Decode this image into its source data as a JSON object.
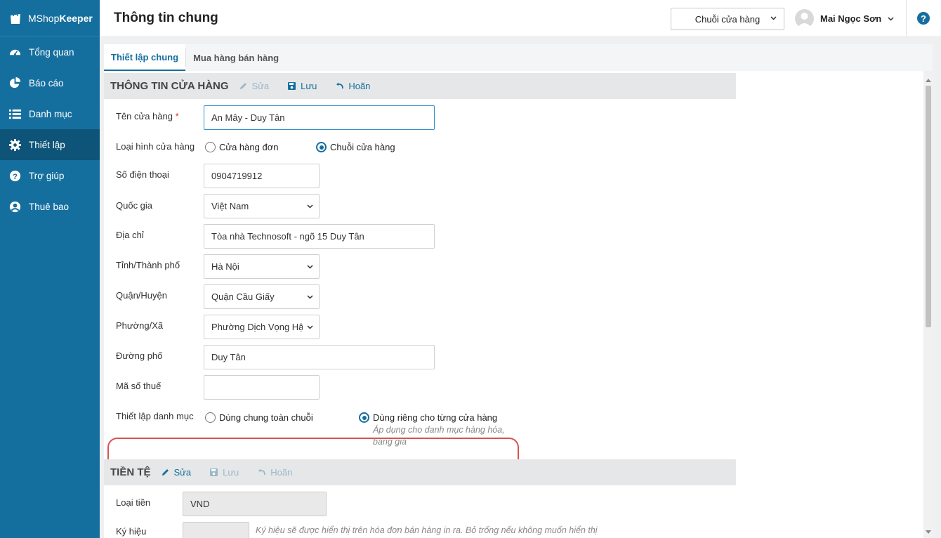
{
  "app": {
    "logo_plain": "MShop",
    "logo_bold": "Keeper"
  },
  "sidebar": {
    "items": [
      {
        "label": "Tổng quan",
        "icon": "dashboard-icon"
      },
      {
        "label": "Báo cáo",
        "icon": "pie-chart-icon"
      },
      {
        "label": "Danh mục",
        "icon": "list-icon"
      },
      {
        "label": "Thiết lập",
        "icon": "gear-icon",
        "active": true
      },
      {
        "label": "Trợ giúp",
        "icon": "help-circle-icon"
      },
      {
        "label": "Thuê bao",
        "icon": "user-circle-icon"
      }
    ]
  },
  "header": {
    "title": "Thông tin chung",
    "store_select": "Chuỗi cửa hàng",
    "user_name": "Mai Ngọc Sơn",
    "help": "?"
  },
  "tabs": [
    {
      "label": "Thiết lập chung",
      "active": true
    },
    {
      "label": "Mua hàng bán hàng"
    }
  ],
  "store_section": {
    "title": "THÔNG TIN CỬA HÀNG",
    "edit": "Sửa",
    "save": "Lưu",
    "cancel": "Hoãn"
  },
  "form": {
    "store_name_label": "Tên cửa hàng",
    "required_mark": "*",
    "store_name_value": "An Mây - Duy Tân",
    "store_type_label": "Loại hình cửa hàng",
    "store_type_single": "Cửa hàng đơn",
    "store_type_chain": "Chuỗi cửa hàng",
    "phone_label": "Số điện thoại",
    "phone_value": "0904719912",
    "country_label": "Quốc gia",
    "country_value": "Việt Nam",
    "address_label": "Địa chỉ",
    "address_value": "Tòa nhà Technosoft - ngõ 15 Duy Tân",
    "province_label": "Tỉnh/Thành phố",
    "province_value": "Hà Nội",
    "district_label": "Quận/Huyện",
    "district_value": "Quận Cầu Giấy",
    "ward_label": "Phường/Xã",
    "ward_value": "Phường Dịch Vọng Hậu",
    "street_label": "Đường phố",
    "street_value": "Duy Tân",
    "tax_label": "Mã số thuế",
    "tax_value": "",
    "category_label": "Thiết lập danh mục",
    "category_shared": "Dùng chung toàn chuỗi",
    "category_separate": "Dùng riêng cho từng cửa hàng",
    "category_note": "Áp dụng cho danh mục hàng hóa, bảng giá"
  },
  "currency_section": {
    "title": "TIỀN TỆ",
    "edit": "Sửa",
    "save": "Lưu",
    "cancel": "Hoãn",
    "currency_label": "Loại tiền",
    "currency_value": "VND",
    "symbol_label": "Ký hiệu",
    "symbol_hint": "Ký hiệu sẽ được hiển thị trên hóa đơn bán hàng in ra. Bỏ trống nếu không muốn hiển thị"
  },
  "colors": {
    "sidebar_bg": "#156f9e",
    "sidebar_active": "#0e5378",
    "accent": "#156f9e",
    "highlight_border": "#d9534f"
  }
}
